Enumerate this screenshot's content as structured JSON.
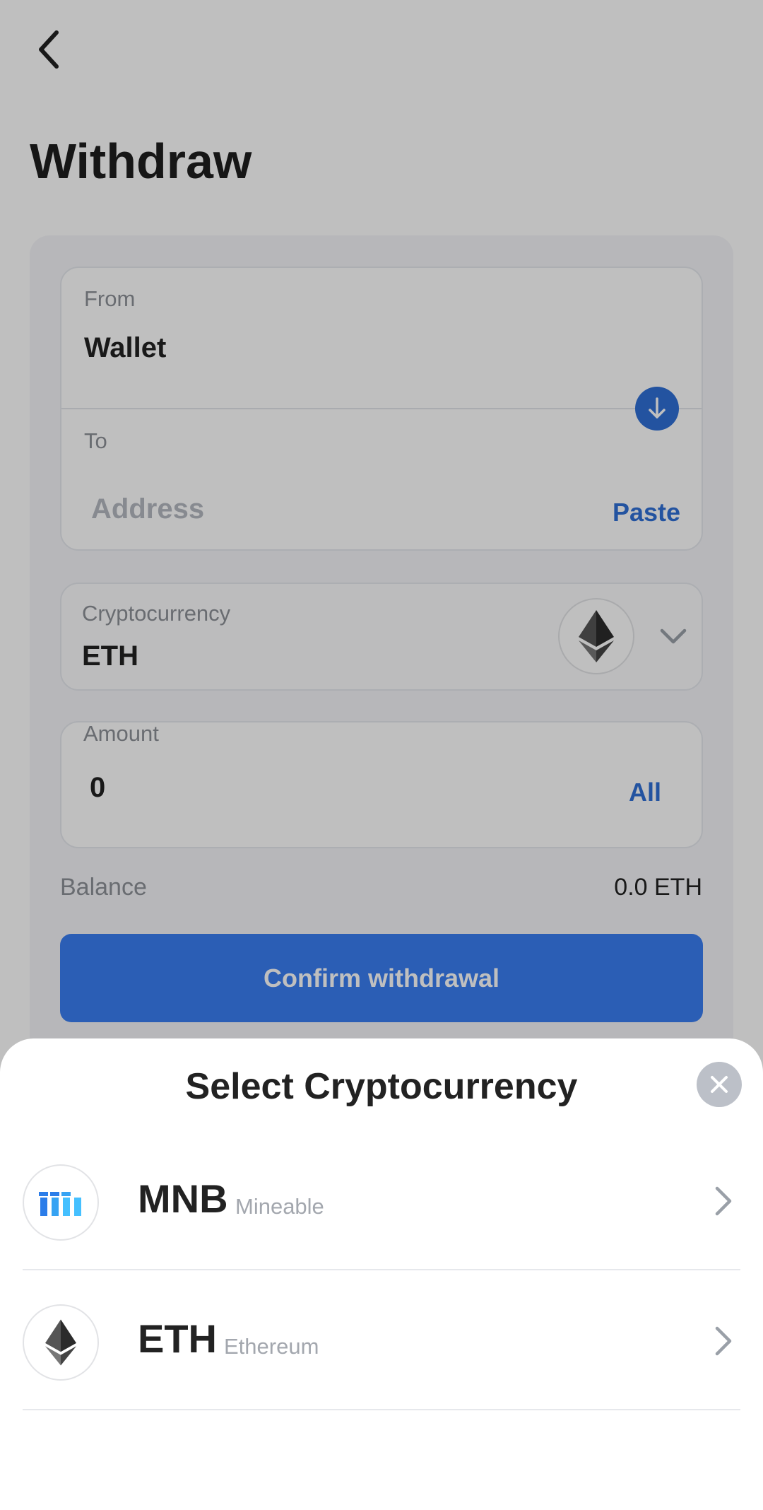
{
  "header": {
    "back_icon": "chevron-left-icon",
    "title": "Withdraw"
  },
  "from": {
    "label": "From",
    "value": "Wallet"
  },
  "swap_icon": "arrow-down-icon",
  "to": {
    "label": "To",
    "placeholder": "Address",
    "paste_label": "Paste"
  },
  "crypto": {
    "label": "Cryptocurrency",
    "value": "ETH",
    "coin_icon": "ethereum-icon",
    "dropdown_icon": "chevron-down-icon"
  },
  "amount": {
    "label": "Amount",
    "value": "0",
    "all_label": "All"
  },
  "balance": {
    "label": "Balance",
    "value": "0.0 ETH"
  },
  "confirm_label": "Confirm withdrawal",
  "sheet": {
    "title": "Select Cryptocurrency",
    "close_icon": "close-icon",
    "items": [
      {
        "symbol": "MNB",
        "name": "Mineable",
        "icon": "mineable-logo-icon"
      },
      {
        "symbol": "ETH",
        "name": "Ethereum",
        "icon": "ethereum-icon"
      }
    ]
  },
  "colors": {
    "accent": "#3a7ef2",
    "dim_overlay": "rgba(0,0,0,0.25)"
  }
}
